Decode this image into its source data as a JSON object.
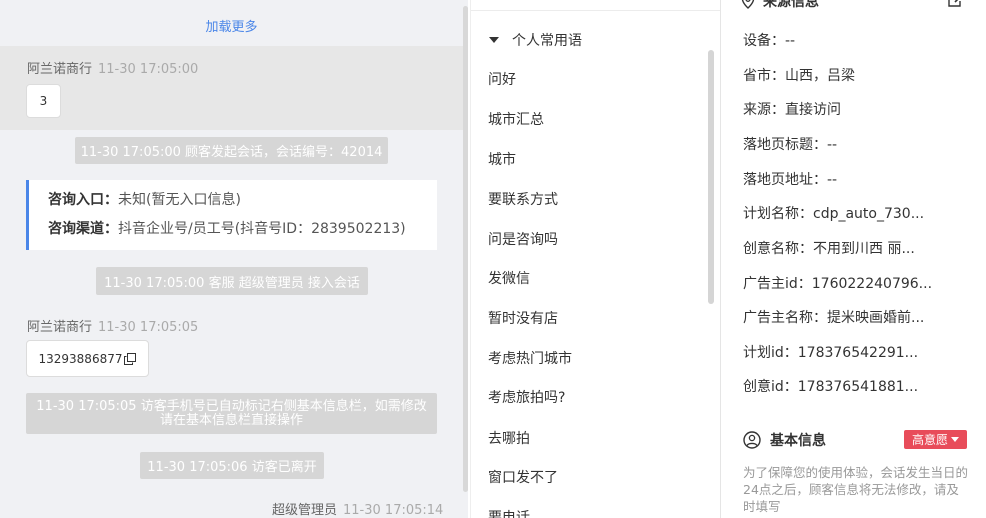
{
  "chat": {
    "load_more": "加载更多",
    "messages": [
      {
        "sender": "阿兰诺商行",
        "time": "11-30 17:05:00",
        "text": "3"
      },
      {
        "sender": "阿兰诺商行",
        "time": "11-30 17:05:05",
        "text": "13293886877"
      },
      {
        "sender": "超级管理员",
        "time": "11-30 17:05:14"
      }
    ],
    "system": [
      "11-30 17:05:00 顾客发起会话，会话编号：42014",
      "11-30 17:05:00 客服 超级管理员 接入会话",
      "11-30 17:05:05 访客手机号已自动标记右侧基本信息栏，如需修改请在基本信息栏直接操作",
      "11-30 17:05:06 访客已离开"
    ],
    "entry": {
      "label1": "咨询入口：",
      "value1": "未知(暂无入口信息)",
      "label2": "咨询渠道：",
      "value2": "抖音企业号/员工号(抖音号ID：2839502213)"
    }
  },
  "phrases": {
    "group_title": "个人常用语",
    "items": [
      "问好",
      "城市汇总",
      "城市",
      "要联系方式",
      "问是咨询吗",
      "发微信",
      "暂时没有店",
      "考虑热门城市",
      "考虑旅拍吗?",
      "去哪拍",
      "窗口发不了",
      "要电话"
    ]
  },
  "info": {
    "source_title": "来源信息",
    "fields": [
      "设备：--",
      "省市：山西，吕梁",
      "来源：直接访问",
      "落地页标题：--",
      "落地页地址：--",
      "计划名称：cdp_auto_730...",
      "创意名称：不用到川西 丽...",
      "广告主id：176022240796...",
      "广告主名称：提米映画婚前...",
      "计划id：178376542291...",
      "创意id：178376541881..."
    ],
    "basic_title": "基本信息",
    "intent_badge": "高意愿",
    "notice": "为了保障您的使用体验，会话发生当日的24点之后，顾客信息将无法修改，请及时填写"
  },
  "colors": {
    "accent": "#4a86e8",
    "badge": "#e84c5a"
  }
}
